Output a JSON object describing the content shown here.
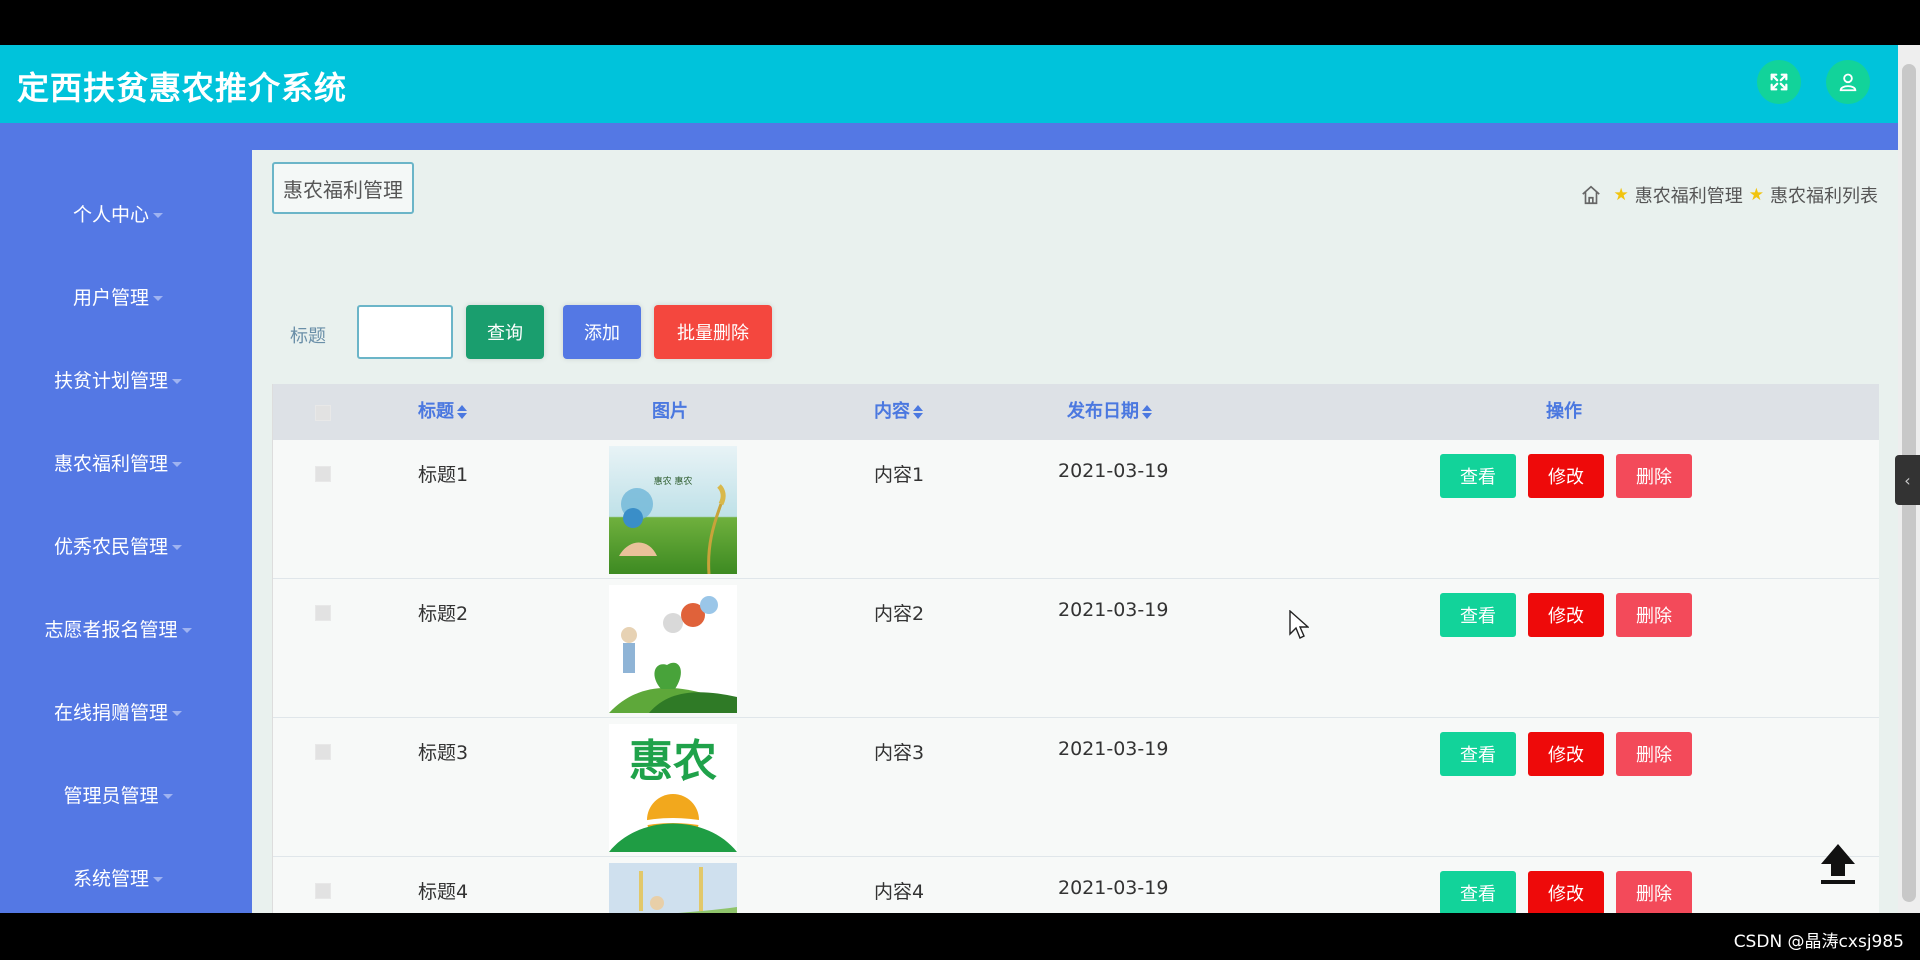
{
  "app": {
    "title": "定西扶贫惠农推介系统"
  },
  "header": {
    "fullscreen_icon": "expand-icon",
    "user_icon": "user-icon"
  },
  "sidebar": {
    "items": [
      {
        "label": "个人中心"
      },
      {
        "label": "用户管理"
      },
      {
        "label": "扶贫计划管理"
      },
      {
        "label": "惠农福利管理"
      },
      {
        "label": "优秀农民管理"
      },
      {
        "label": "志愿者报名管理"
      },
      {
        "label": "在线捐赠管理"
      },
      {
        "label": "管理员管理"
      },
      {
        "label": "系统管理"
      }
    ]
  },
  "page": {
    "section_tag": "惠农福利管理",
    "breadcrumb": {
      "level1": "惠农福利管理",
      "level2": "惠农福利列表"
    }
  },
  "search": {
    "label": "标题",
    "value": "",
    "query_label": "查询",
    "add_label": "添加",
    "batch_delete_label": "批量删除"
  },
  "table": {
    "headers": {
      "title": "标题",
      "image": "图片",
      "content": "内容",
      "date": "发布日期",
      "actions": "操作"
    },
    "rows": [
      {
        "title": "标题1",
        "content": "内容1",
        "date": "2021-03-19",
        "image_text": "惠农 惠农"
      },
      {
        "title": "标题2",
        "content": "内容2",
        "date": "2021-03-19",
        "image_text": ""
      },
      {
        "title": "标题3",
        "content": "内容3",
        "date": "2021-03-19",
        "image_text": "惠农"
      },
      {
        "title": "标题4",
        "content": "内容4",
        "date": "2021-03-19",
        "image_text": ""
      }
    ],
    "action_labels": {
      "view": "查看",
      "edit": "修改",
      "delete": "删除"
    }
  },
  "colors": {
    "header": "#00c3db",
    "sidebar": "#5478e4",
    "query": "#1a9e6e",
    "add": "#5478e4",
    "batch_delete": "#f4473e",
    "view": "#12d39a",
    "edit": "#ee0a0a",
    "delete": "#f34a5a"
  },
  "watermark": "CSDN @晶涛cxsj985"
}
